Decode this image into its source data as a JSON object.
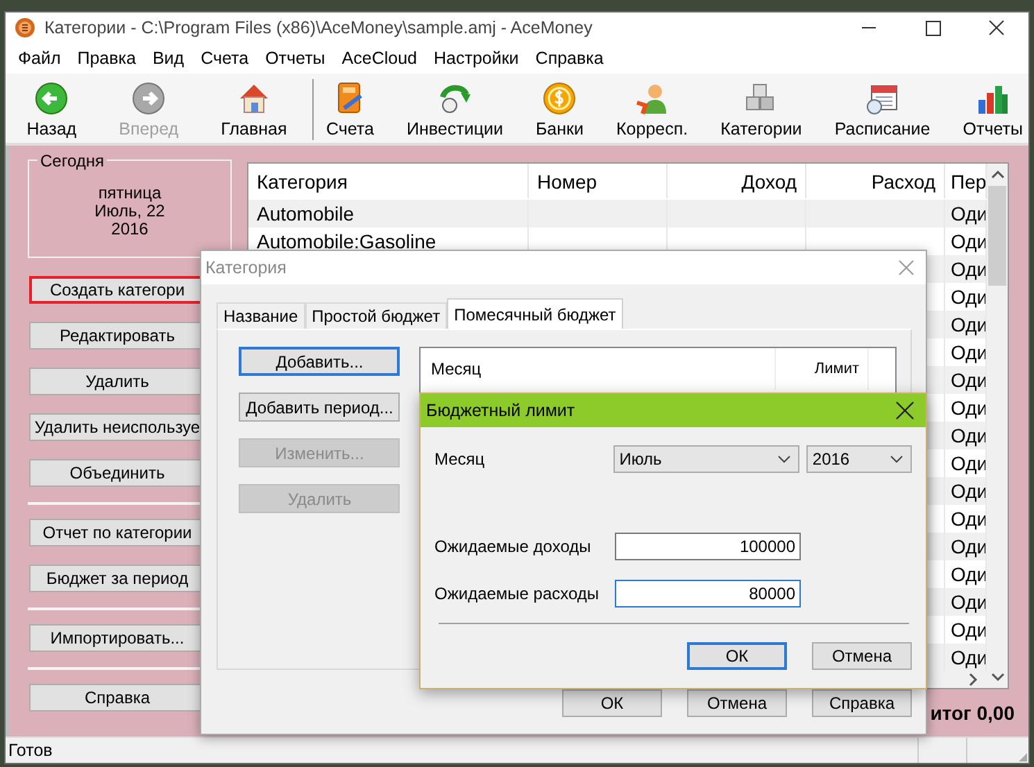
{
  "window": {
    "title": "Категории - C:\\Program Files (x86)\\AceMoney\\sample.amj - AceMoney"
  },
  "menu": [
    "Файл",
    "Правка",
    "Вид",
    "Счета",
    "Отчеты",
    "AceCloud",
    "Настройки",
    "Справка"
  ],
  "toolbar": {
    "navigation": [
      {
        "label": "Назад",
        "disabled": false
      },
      {
        "label": "Вперед",
        "disabled": true
      },
      {
        "label": "Главная",
        "disabled": false
      }
    ],
    "sections": [
      {
        "label": "Счета",
        "disabled": false
      },
      {
        "label": "Инвестиции",
        "disabled": false
      },
      {
        "label": "Банки",
        "disabled": false
      },
      {
        "label": "Корресп.",
        "disabled": false
      },
      {
        "label": "Категории",
        "disabled": false
      },
      {
        "label": "Расписание",
        "disabled": false
      },
      {
        "label": "Отчеты",
        "disabled": false
      }
    ]
  },
  "today": {
    "label": "Сегодня",
    "lines": [
      "пятница",
      "Июль, 22",
      "2016"
    ]
  },
  "side_buttons": [
    [
      {
        "label": "Создать категори",
        "selected": true
      },
      {
        "label": "Редактировать",
        "selected": false
      },
      {
        "label": "Удалить",
        "selected": false
      },
      {
        "label": "Удалить неиспользуе",
        "selected": false
      },
      {
        "label": "Объединить",
        "selected": false
      }
    ],
    [
      {
        "label": "Отчет по категории",
        "selected": false
      },
      {
        "label": "Бюджет за период",
        "selected": false
      }
    ],
    [
      {
        "label": "Импортировать...",
        "selected": false
      }
    ],
    [
      {
        "label": "Справка",
        "selected": false
      }
    ]
  ],
  "table": {
    "columns": [
      "Категория",
      "Номер",
      "Доход",
      "Расход",
      "Пер"
    ],
    "rows": [
      {
        "category": "Automobile",
        "column_5": "Оди"
      },
      {
        "category": "Automobile:Gasoline",
        "column_5": "Оди"
      },
      {
        "column_5": "Оди"
      },
      {
        "column_5": "Оди"
      },
      {
        "column_5": "Оди"
      },
      {
        "column_5": "Оди"
      },
      {
        "column_5": "Оди"
      },
      {
        "column_5": "Оди"
      },
      {
        "column_5": "Оди"
      },
      {
        "column_5": "Оди"
      },
      {
        "column_5": "Оди"
      },
      {
        "column_5": "Оди"
      },
      {
        "column_5": "Оди"
      },
      {
        "column_5": "Оди"
      },
      {
        "column_5": "Оди"
      },
      {
        "column_5": "Оди"
      },
      {
        "column_5": "Оди"
      }
    ],
    "total": "итог 0,00"
  },
  "status_bar": "Готов",
  "category_dialog": {
    "title": "Категория",
    "tabs": [
      {
        "label": "Название",
        "selected": false
      },
      {
        "label": "Простой бюджет",
        "selected": false
      },
      {
        "label": "Помесячный бюджет",
        "selected": true
      }
    ],
    "buttons": [
      {
        "label": "Добавить...",
        "disabled": false,
        "focused": true
      },
      {
        "label": "Добавить период...",
        "disabled": false,
        "focused": false
      },
      {
        "label": "Изменить...",
        "disabled": true,
        "focused": false
      },
      {
        "label": "Удалить",
        "disabled": true,
        "focused": false
      }
    ],
    "list_columns": [
      "Месяц",
      "Лимит"
    ],
    "footer_buttons": [
      "ОК",
      "Отмена",
      "Справка"
    ]
  },
  "budget_dialog": {
    "title": "Бюджетный лимит",
    "month": {
      "label": "Месяц",
      "month": "Июль",
      "year": "2016"
    },
    "fields": [
      {
        "label": "Ожидаемые доходы",
        "value": "100000",
        "focused": false
      },
      {
        "label": "Ожидаемые расходы",
        "value": "80000",
        "focused": true
      }
    ],
    "buttons": [
      {
        "label": "ОК",
        "default": true
      },
      {
        "label": "Отмена",
        "default": false
      }
    ]
  }
}
